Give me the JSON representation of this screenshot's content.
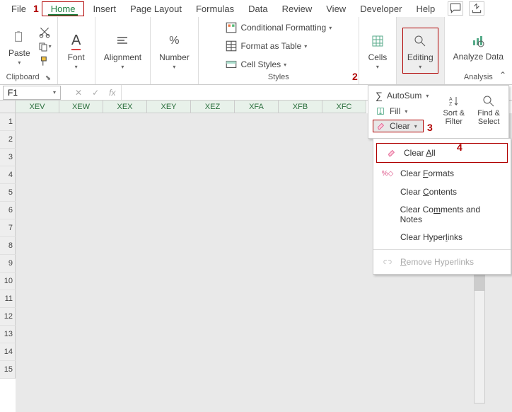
{
  "tabs": [
    "File",
    "Home",
    "Insert",
    "Page Layout",
    "Formulas",
    "Data",
    "Review",
    "View",
    "Developer",
    "Help"
  ],
  "ribbon": {
    "clipboard": {
      "paste": "Paste",
      "label": "Clipboard"
    },
    "font": {
      "btn": "Font"
    },
    "alignment": {
      "btn": "Alignment"
    },
    "number": {
      "btn": "Number"
    },
    "styles": {
      "cond": "Conditional Formatting",
      "table": "Format as Table",
      "cell": "Cell Styles",
      "label": "Styles"
    },
    "cells": {
      "btn": "Cells"
    },
    "editing": {
      "btn": "Editing"
    },
    "analysis": {
      "btn": "Analyze Data",
      "label": "Analysis"
    }
  },
  "namebox": "F1",
  "columns": [
    "XEV",
    "XEW",
    "XEX",
    "XEY",
    "XEZ",
    "XFA",
    "XFB",
    "XFC"
  ],
  "rows": [
    "1",
    "2",
    "3",
    "4",
    "5",
    "6",
    "7",
    "8",
    "9",
    "10",
    "11",
    "12",
    "13",
    "14",
    "15"
  ],
  "panel": {
    "autosum": "AutoSum",
    "fill": "Fill",
    "clear": "Clear",
    "sort": "Sort & Filter",
    "find": "Find & Select"
  },
  "submenu": {
    "clear_all": "Clear All",
    "clear_formats": "Clear Formats",
    "clear_contents": "Clear Contents",
    "clear_comments": "Clear Comments and Notes",
    "clear_hyperlinks": "Clear Hyperlinks",
    "remove_hyperlinks": "Remove Hyperlinks"
  },
  "annos": {
    "a1": "1",
    "a2": "2",
    "a3": "3",
    "a4": "4"
  }
}
